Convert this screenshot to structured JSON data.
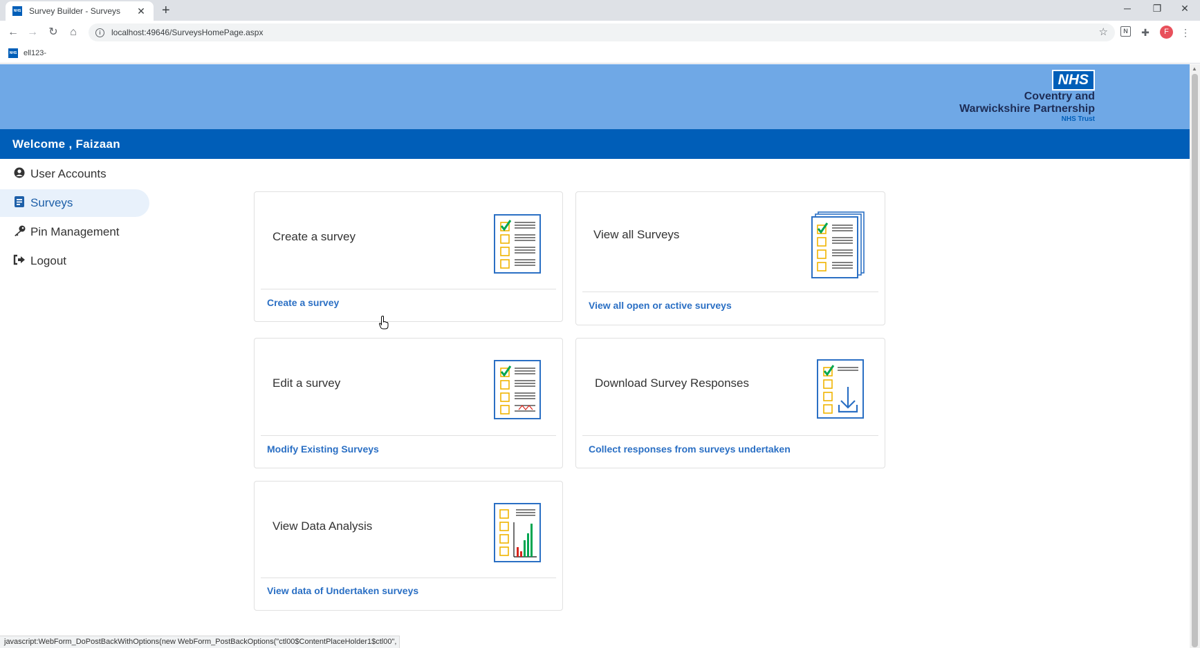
{
  "browser": {
    "tab_title": "Survey Builder - Surveys",
    "url": "localhost:49646/SurveysHomePage.aspx",
    "bookmark": "ell123-",
    "favicon_text": "NHS",
    "profile_initial": "F",
    "status_text": "javascript:WebForm_DoPostBackWithOptions(new WebForm_PostBackOptions(\"ctl00$ContentPlaceHolder1$ctl00\", \"\"..."
  },
  "header": {
    "logo_badge": "NHS",
    "logo_line1": "Coventry and",
    "logo_line2": "Warwickshire Partnership",
    "logo_line3": "NHS Trust"
  },
  "welcome": "Welcome , Faizaan",
  "sidebar": {
    "items": [
      {
        "label": "User Accounts",
        "icon": "user-circle-icon"
      },
      {
        "label": "Surveys",
        "icon": "document-icon"
      },
      {
        "label": "Pin Management",
        "icon": "key-icon"
      },
      {
        "label": "Logout",
        "icon": "logout-icon"
      }
    ],
    "active": "Surveys"
  },
  "cards": [
    {
      "title": "Create a survey",
      "link": "Create a survey"
    },
    {
      "title": "View all Surveys",
      "link": "View all open or active surveys"
    },
    {
      "title": "Edit a survey",
      "link": "Modify Existing Surveys"
    },
    {
      "title": "Download Survey Responses",
      "link": "Collect responses from surveys undertaken"
    },
    {
      "title": "View Data Analysis",
      "link": "View data of Undertaken surveys"
    }
  ],
  "colors": {
    "header_bg": "#6fa8e6",
    "welcome_bg": "#005eb8",
    "link": "#2a6fc4",
    "checklist_border": "#2a6fc4",
    "checkbox": "#f0b400",
    "check": "#00a651"
  }
}
